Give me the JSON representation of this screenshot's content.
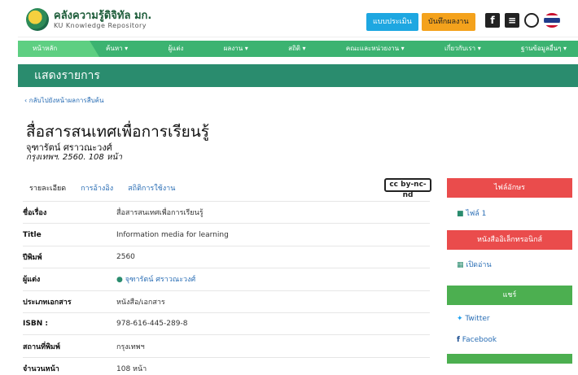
{
  "header": {
    "logo_title": "คลังความรู้ดิจิทัล มก.",
    "logo_sub": "KU Knowledge Repository",
    "btn_eval": "แบบประเมิน",
    "btn_record": "บันทึกผลงาน"
  },
  "nav": {
    "items": [
      "หน้าหลัก",
      "ค้นหา ▾",
      "ผู้แต่ง",
      "ผลงาน ▾",
      "สถิติ ▾",
      "คณะและหน่วยงาน ▾",
      "เกี่ยวกับเรา ▾",
      "ฐานข้อมูลอื่นๆ ▾"
    ]
  },
  "band_title": "แสดงรายการ",
  "back_link": "‹ กลับไปยังหน้าผลการสืบค้น",
  "record": {
    "title": "สื่อสารสนเทศเพื่อการเรียนรู้",
    "author": "จุฑารัตน์ ศราวณะวงศ์",
    "pub": "กรุงเทพฯ. 2560. 108 หน้า"
  },
  "tabs": [
    "รายละเอียด",
    "การอ้างอิง",
    "สถิติการใช้งาน"
  ],
  "license": "cc by-nc-nd",
  "meta": [
    {
      "k": "ชื่อเรื่อง",
      "v": "สื่อสารสนเทศเพื่อการเรียนรู้"
    },
    {
      "k": "Title",
      "v": "Information media for learning"
    },
    {
      "k": "ปีพิมพ์",
      "v": "2560"
    },
    {
      "k": "ผู้แต่ง",
      "v": "จุฑารัตน์ ศราวณะวงศ์"
    },
    {
      "k": "ประเภทเอกสาร",
      "v": "หนังสือ/เอกสาร"
    },
    {
      "k": "ISBN :",
      "v": "978-616-445-289-8"
    },
    {
      "k": "สถานที่พิมพ์",
      "v": "กรุงเทพฯ"
    },
    {
      "k": "จำนวนหน้า",
      "v": "108 หน้า"
    }
  ],
  "sidebar": {
    "file_btn": "ไฟล์อักษร",
    "file_link": "ไฟล์ 1",
    "ebook_btn": "หนังสืออิเล็กทรอนิกส์",
    "ebook_link": "เปิดอ่าน",
    "share_btn": "แชร์",
    "twitter": "Twitter",
    "facebook": "Facebook"
  }
}
